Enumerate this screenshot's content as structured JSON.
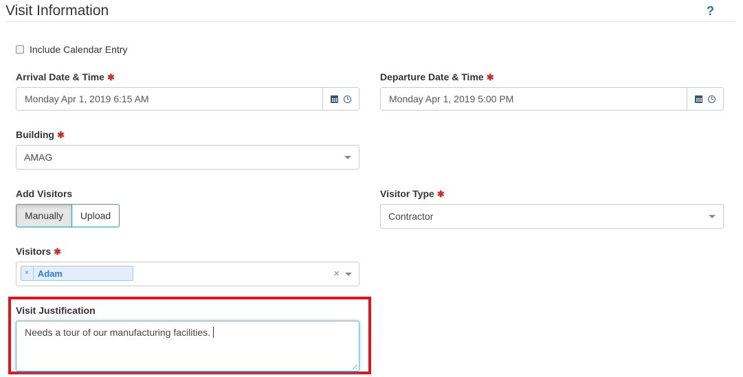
{
  "header": {
    "title": "Visit Information",
    "help": "?"
  },
  "calendar_entry": {
    "label": "Include Calendar Entry",
    "checked": false
  },
  "arrival": {
    "label": "Arrival Date & Time",
    "required": "✱",
    "value": "Monday Apr 1, 2019 6:15 AM"
  },
  "departure": {
    "label": "Departure Date & Time",
    "required": "✱",
    "value": "Monday Apr 1, 2019 5:00 PM"
  },
  "building": {
    "label": "Building",
    "required": "✱",
    "value": "AMAG"
  },
  "add_visitors": {
    "label": "Add Visitors",
    "options": [
      "Manually",
      "Upload"
    ],
    "selected": "Manually"
  },
  "visitor_type": {
    "label": "Visitor Type",
    "required": "✱",
    "value": "Contractor"
  },
  "visitors": {
    "label": "Visitors",
    "required": "✱",
    "tags": [
      "Adam"
    ],
    "remove": "×",
    "clear": "×"
  },
  "justification": {
    "label": "Visit Justification",
    "value": "Needs a tour of our manufacturing facilities."
  },
  "colors": {
    "accent": "#3a9ea7",
    "required": "#c9302c",
    "highlight": "#e0141e",
    "tag_text": "#2f7bd6"
  }
}
